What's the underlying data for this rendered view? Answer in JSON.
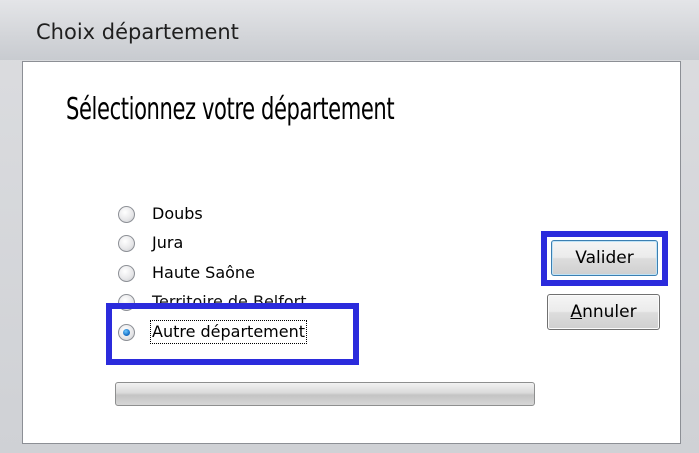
{
  "window": {
    "title": "Choix département"
  },
  "heading": "Sélectionnez votre département",
  "options": [
    {
      "label": "Doubs",
      "checked": false
    },
    {
      "label": "Jura",
      "checked": false
    },
    {
      "label": "Haute Saône",
      "checked": false
    },
    {
      "label": "Territoire de Belfort",
      "checked": false
    },
    {
      "label": "Autre département",
      "checked": true
    }
  ],
  "buttons": {
    "validate": "Valider",
    "cancel_mnemonic": "A",
    "cancel_rest": "nnuler"
  },
  "progress": {
    "value": 0
  },
  "colors": {
    "highlight": "#2b2bdc",
    "radio_selected": "#1a74c9"
  }
}
